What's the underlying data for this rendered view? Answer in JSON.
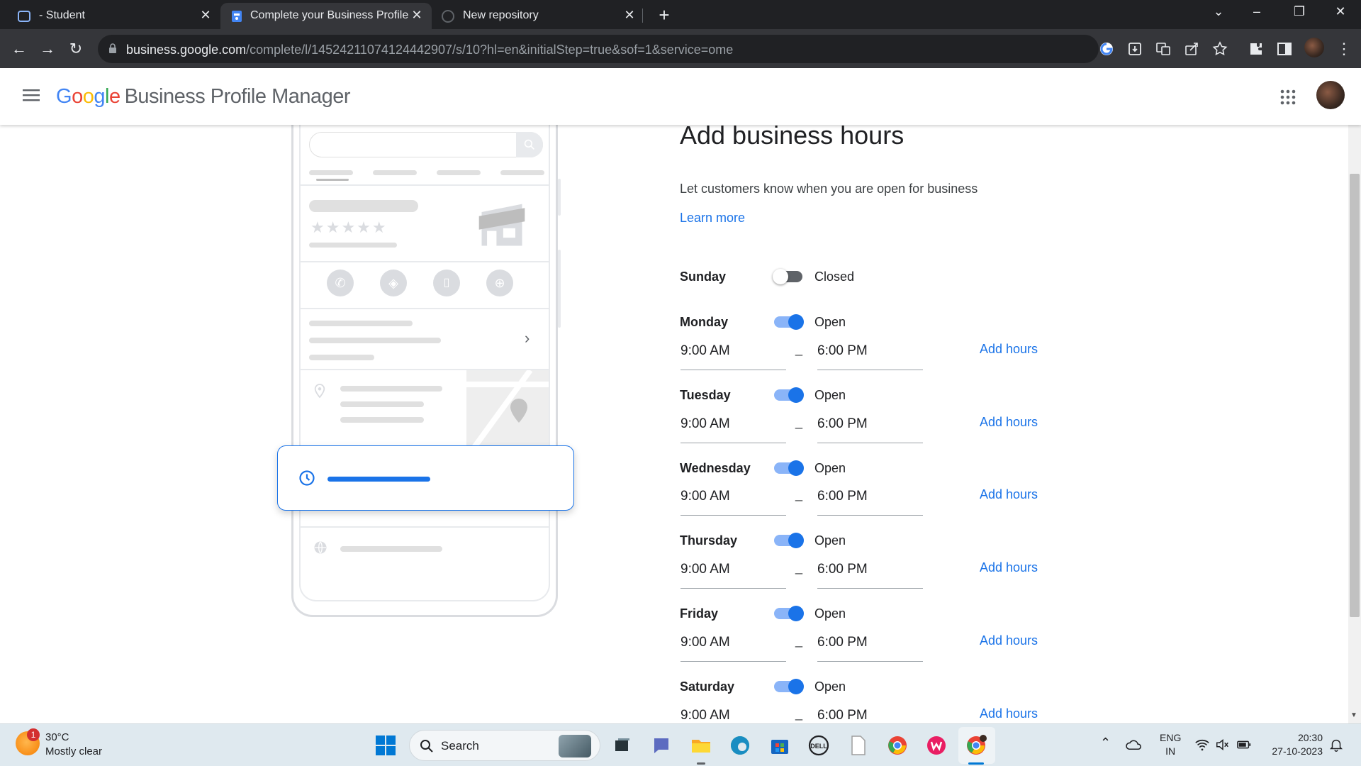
{
  "browser": {
    "tabs": [
      {
        "title": "- Student",
        "active": false
      },
      {
        "title": "Complete your Business Profile",
        "active": true
      },
      {
        "title": "New repository",
        "active": false
      }
    ],
    "url_host": "business.google.com",
    "url_path": "/complete/l/14524211074124442907/s/10?hl=en&initialStep=true&sof=1&service=ome"
  },
  "header": {
    "logo_letters": [
      "G",
      "o",
      "o",
      "g",
      "l",
      "e"
    ],
    "logo_colors": [
      "#4285f4",
      "#ea4335",
      "#fbbc05",
      "#4285f4",
      "#34a853",
      "#ea4335"
    ],
    "product_name": "Business Profile Manager"
  },
  "form": {
    "title": "Add business hours",
    "subtitle": "Let customers know when you are open for business",
    "learn_more": "Learn more",
    "add_hours_label": "Add hours",
    "days": [
      {
        "name": "Sunday",
        "open": false,
        "status": "Closed"
      },
      {
        "name": "Monday",
        "open": true,
        "status": "Open",
        "from": "9:00 AM",
        "to": "6:00 PM"
      },
      {
        "name": "Tuesday",
        "open": true,
        "status": "Open",
        "from": "9:00 AM",
        "to": "6:00 PM"
      },
      {
        "name": "Wednesday",
        "open": true,
        "status": "Open",
        "from": "9:00 AM",
        "to": "6:00 PM"
      },
      {
        "name": "Thursday",
        "open": true,
        "status": "Open",
        "from": "9:00 AM",
        "to": "6:00 PM"
      },
      {
        "name": "Friday",
        "open": true,
        "status": "Open",
        "from": "9:00 AM",
        "to": "6:00 PM"
      },
      {
        "name": "Saturday",
        "open": true,
        "status": "Open",
        "from": "9:00 AM",
        "to": "6:00 PM"
      }
    ]
  },
  "taskbar": {
    "weather_badge": "1",
    "temperature": "30°C",
    "weather": "Mostly clear",
    "search_label": "Search",
    "lang_line1": "ENG",
    "lang_line2": "IN",
    "time": "20:30",
    "date": "27-10-2023"
  },
  "colors": {
    "accent": "#1a73e8",
    "tab_bg": "#202124",
    "toolbar_bg": "#35363a"
  }
}
